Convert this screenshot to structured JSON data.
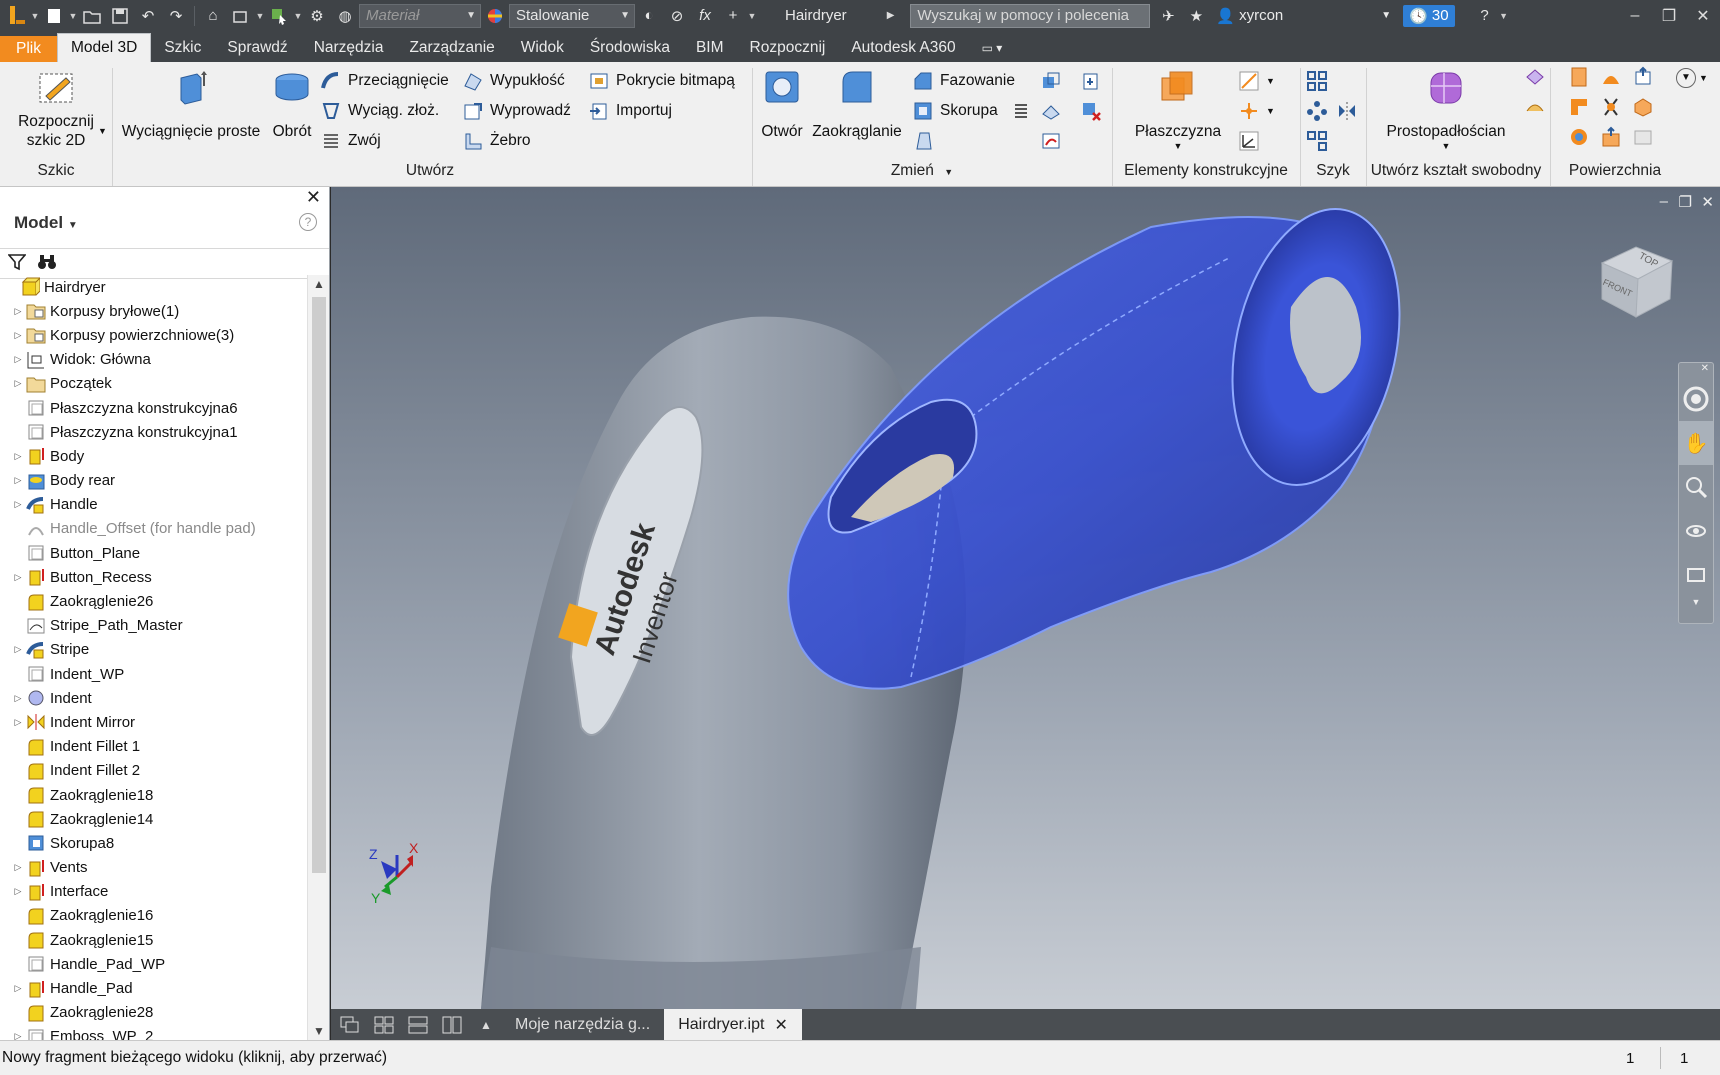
{
  "titlebar": {
    "material_placeholder": "Materiał",
    "appearance_value": "Stalowanie",
    "doc_title": "Hairdryer",
    "search_placeholder": "Wyszukaj w pomocy i polecenia",
    "user_name": "xyrcon",
    "clock_count": "30"
  },
  "tabs": [
    {
      "label": "Plik"
    },
    {
      "label": "Model 3D"
    },
    {
      "label": "Szkic"
    },
    {
      "label": "Sprawdź"
    },
    {
      "label": "Narzędzia"
    },
    {
      "label": "Zarządzanie"
    },
    {
      "label": "Widok"
    },
    {
      "label": "Środowiska"
    },
    {
      "label": "BIM"
    },
    {
      "label": "Rozpocznij"
    },
    {
      "label": "Autodesk A360"
    }
  ],
  "ribbon": {
    "sketch": {
      "start_line1": "Rozpocznij",
      "start_line2": "szkic 2D",
      "panel": "Szkic"
    },
    "create": {
      "extrude": "Wyciągnięcie proste",
      "revolve": "Obrót",
      "sweep": "Przeciągnięcie",
      "loft": "Wyciąg. złoż.",
      "coil": "Zwój",
      "emboss": "Wypukłość",
      "derive": "Wyprowadź",
      "rib": "Żebro",
      "decal": "Pokrycie bitmapą",
      "import": "Importuj",
      "panel": "Utwórz"
    },
    "modify": {
      "hole": "Otwór",
      "fillet": "Zaokrąglanie",
      "chamfer": "Fazowanie",
      "shell": "Skorupa",
      "panel": "Zmień"
    },
    "work_features": {
      "plane": "Płaszczyzna",
      "panel": "Elementy konstrukcyjne"
    },
    "pattern": {
      "panel": "Szyk"
    },
    "freeform": {
      "box": "Prostopadłościan",
      "panel": "Utwórz kształt swobodny"
    },
    "surface": {
      "panel": "Powierzchnia"
    }
  },
  "browser": {
    "title": "Model",
    "items": [
      {
        "label": "Hairdryer"
      },
      {
        "label": "Korpusy bryłowe(1)"
      },
      {
        "label": "Korpusy powierzchniowe(3)"
      },
      {
        "label": "Widok: Główna"
      },
      {
        "label": "Początek"
      },
      {
        "label": "Płaszczyzna konstrukcyjna6"
      },
      {
        "label": "Płaszczyzna konstrukcyjna1"
      },
      {
        "label": "Body"
      },
      {
        "label": "Body rear"
      },
      {
        "label": "Handle"
      },
      {
        "label": "Handle_Offset (for handle pad)"
      },
      {
        "label": "Button_Plane"
      },
      {
        "label": "Button_Recess"
      },
      {
        "label": "Zaokrąglenie26"
      },
      {
        "label": "Stripe_Path_Master"
      },
      {
        "label": "Stripe"
      },
      {
        "label": "Indent_WP"
      },
      {
        "label": "Indent"
      },
      {
        "label": "Indent Mirror"
      },
      {
        "label": "Indent Fillet 1"
      },
      {
        "label": "Indent Fillet 2"
      },
      {
        "label": "Zaokrąglenie18"
      },
      {
        "label": "Zaokrąglenie14"
      },
      {
        "label": "Skorupa8"
      },
      {
        "label": "Vents"
      },
      {
        "label": "Interface"
      },
      {
        "label": "Zaokrąglenie16"
      },
      {
        "label": "Zaokrąglenie15"
      },
      {
        "label": "Handle_Pad_WP"
      },
      {
        "label": "Handle_Pad"
      },
      {
        "label": "Zaokrąglenie28"
      },
      {
        "label": "Emboss_WP_2"
      }
    ]
  },
  "viewport": {
    "decal_line1": "Autodesk",
    "decal_line2": "Inventor",
    "viewcube_top": "TOP",
    "viewcube_front": "FRONT",
    "triad_x": "X",
    "triad_y": "Y",
    "triad_z": "Z"
  },
  "doc_tabs": [
    {
      "label": "Moje narzędzia g..."
    },
    {
      "label": "Hairdryer.ipt"
    }
  ],
  "status": {
    "message": "Nowy fragment bieżącego widoku (kliknij, aby przerwać)",
    "count1": "1",
    "count2": "1"
  },
  "colors": {
    "file_tab": "#f28b1f",
    "clock_badge": "#2f7fd6",
    "selection_blue": "#3a5bd8",
    "body_gray": "#8d96a3"
  }
}
